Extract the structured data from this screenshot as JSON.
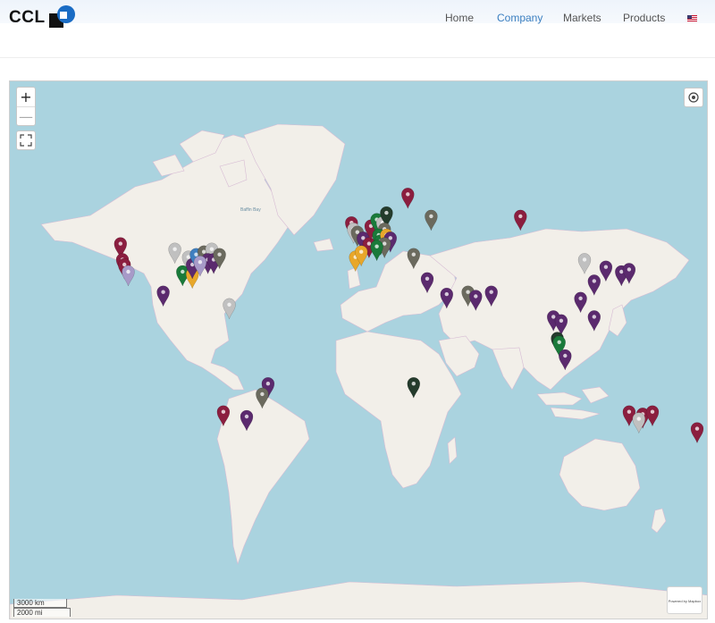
{
  "header": {
    "logo_text": "CCL",
    "nav": {
      "home": "Home",
      "company": "Company",
      "markets": "Markets",
      "products": "Products"
    },
    "language": "en-US flag"
  },
  "map": {
    "zoom_in": "+",
    "zoom_out": "—",
    "scale_km": "3000 km",
    "scale_mi": "2000 mi",
    "attribution": "Powered by Mapbox",
    "water_label": "Baffin Bay",
    "colors": {
      "water": "#aad3df",
      "land": "#f2efe9",
      "border": "#d7bcd4",
      "pin_red": "#8b1e3f",
      "pin_purple": "#5b2a6e",
      "pin_grey": "#6b6a5e",
      "pin_light": "#c0c0c0",
      "pin_green": "#1a7a3a",
      "pin_dark": "#243b2c",
      "pin_yellow": "#e8a72a",
      "pin_lilac": "#a79ac8",
      "pin_blue": "#3f7fbf"
    },
    "markers": [
      {
        "lat": 46,
        "lon": -123,
        "c": "pin_red"
      },
      {
        "lat": 40,
        "lon": -122,
        "c": "pin_red"
      },
      {
        "lat": 38,
        "lon": -121,
        "c": "pin_red"
      },
      {
        "lat": 35,
        "lon": -119,
        "c": "pin_lilac"
      },
      {
        "lat": 44,
        "lon": -95,
        "c": "pin_light"
      },
      {
        "lat": 41,
        "lon": -88,
        "c": "pin_light"
      },
      {
        "lat": 35,
        "lon": -91,
        "c": "pin_green"
      },
      {
        "lat": 34,
        "lon": -86,
        "c": "pin_yellow"
      },
      {
        "lat": 38,
        "lon": -86,
        "c": "pin_purple"
      },
      {
        "lat": 42,
        "lon": -84,
        "c": "pin_blue"
      },
      {
        "lat": 43,
        "lon": -80,
        "c": "pin_grey"
      },
      {
        "lat": 44,
        "lon": -76,
        "c": "pin_light"
      },
      {
        "lat": 40,
        "lon": -78,
        "c": "pin_purple"
      },
      {
        "lat": 39,
        "lon": -82,
        "c": "pin_lilac"
      },
      {
        "lat": 40,
        "lon": -75,
        "c": "pin_purple"
      },
      {
        "lat": 42,
        "lon": -72,
        "c": "pin_grey"
      },
      {
        "lat": 26,
        "lon": -101,
        "c": "pin_purple"
      },
      {
        "lat": 20,
        "lon": -67,
        "c": "pin_light"
      },
      {
        "lat": -20,
        "lon": -47,
        "c": "pin_purple"
      },
      {
        "lat": -25,
        "lon": -50,
        "c": "pin_grey"
      },
      {
        "lat": -33,
        "lon": -70,
        "c": "pin_red"
      },
      {
        "lat": -35,
        "lon": -58,
        "c": "pin_purple"
      },
      {
        "lat": 53,
        "lon": -4,
        "c": "pin_red"
      },
      {
        "lat": 51,
        "lon": -3,
        "c": "pin_light"
      },
      {
        "lat": 50,
        "lon": -1,
        "c": "pin_grey"
      },
      {
        "lat": 48,
        "lon": 2,
        "c": "pin_purple"
      },
      {
        "lat": 46,
        "lon": 5,
        "c": "pin_red"
      },
      {
        "lat": 41,
        "lon": -2,
        "c": "pin_yellow"
      },
      {
        "lat": 43,
        "lon": 1,
        "c": "pin_yellow"
      },
      {
        "lat": 52,
        "lon": 6,
        "c": "pin_red"
      },
      {
        "lat": 54,
        "lon": 9,
        "c": "pin_green"
      },
      {
        "lat": 53,
        "lon": 12,
        "c": "pin_light"
      },
      {
        "lat": 56,
        "lon": 14,
        "c": "pin_dark"
      },
      {
        "lat": 51,
        "lon": 13,
        "c": "pin_grey"
      },
      {
        "lat": 49,
        "lon": 10,
        "c": "pin_green"
      },
      {
        "lat": 47,
        "lon": 11,
        "c": "pin_green"
      },
      {
        "lat": 49,
        "lon": 14,
        "c": "pin_yellow"
      },
      {
        "lat": 48,
        "lon": 16,
        "c": "pin_purple"
      },
      {
        "lat": 46,
        "lon": 13,
        "c": "pin_grey"
      },
      {
        "lat": 45,
        "lon": 9,
        "c": "pin_green"
      },
      {
        "lat": 61,
        "lon": 25,
        "c": "pin_red"
      },
      {
        "lat": 55,
        "lon": 37,
        "c": "pin_grey"
      },
      {
        "lat": 42,
        "lon": 28,
        "c": "pin_grey"
      },
      {
        "lat": 32,
        "lon": 35,
        "c": "pin_purple"
      },
      {
        "lat": 25,
        "lon": 45,
        "c": "pin_purple"
      },
      {
        "lat": 26,
        "lon": 56,
        "c": "pin_grey"
      },
      {
        "lat": 24,
        "lon": 60,
        "c": "pin_purple"
      },
      {
        "lat": 26,
        "lon": 68,
        "c": "pin_purple"
      },
      {
        "lat": 55,
        "lon": 83,
        "c": "pin_red"
      },
      {
        "lat": 40,
        "lon": 116,
        "c": "pin_light"
      },
      {
        "lat": 37,
        "lon": 127,
        "c": "pin_purple"
      },
      {
        "lat": 35,
        "lon": 135,
        "c": "pin_purple"
      },
      {
        "lat": 36,
        "lon": 139,
        "c": "pin_purple"
      },
      {
        "lat": 31,
        "lon": 121,
        "c": "pin_purple"
      },
      {
        "lat": 23,
        "lon": 114,
        "c": "pin_purple"
      },
      {
        "lat": 14,
        "lon": 121,
        "c": "pin_purple"
      },
      {
        "lat": 14,
        "lon": 100,
        "c": "pin_purple"
      },
      {
        "lat": 12,
        "lon": 104,
        "c": "pin_purple"
      },
      {
        "lat": 3,
        "lon": 102,
        "c": "pin_dark"
      },
      {
        "lat": 1,
        "lon": 103,
        "c": "pin_green"
      },
      {
        "lat": -6,
        "lon": 106,
        "c": "pin_purple"
      },
      {
        "lat": -20,
        "lon": 28,
        "c": "pin_dark"
      },
      {
        "lat": -33,
        "lon": 139,
        "c": "pin_red"
      },
      {
        "lat": -34,
        "lon": 146,
        "c": "pin_red"
      },
      {
        "lat": -36,
        "lon": 144,
        "c": "pin_light"
      },
      {
        "lat": -33,
        "lon": 151,
        "c": "pin_red"
      },
      {
        "lat": -40,
        "lon": 174,
        "c": "pin_red"
      }
    ]
  }
}
